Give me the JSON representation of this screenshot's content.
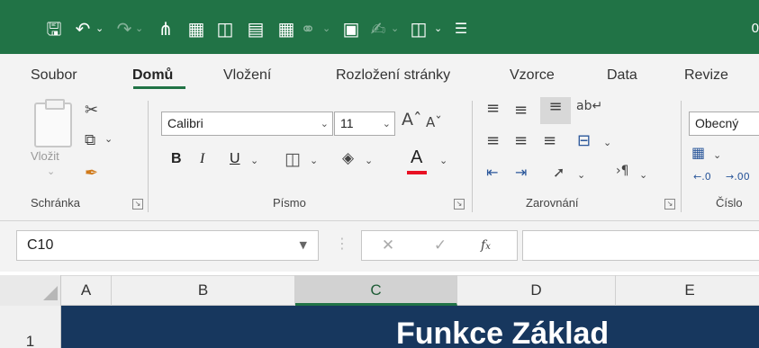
{
  "qat": {
    "title_fragment": "0"
  },
  "tabs": [
    {
      "label": "Soubor"
    },
    {
      "label": "Domů"
    },
    {
      "label": "Vložení"
    },
    {
      "label": "Rozložení stránky"
    },
    {
      "label": "Vzorce"
    },
    {
      "label": "Data"
    },
    {
      "label": "Revize"
    }
  ],
  "clipboard": {
    "paste_label": "Vložit",
    "group_label": "Schránka"
  },
  "font": {
    "name": "Calibri",
    "size": "11",
    "group_label": "Písmo",
    "bold": "B",
    "italic": "I",
    "underline": "U",
    "font_color_letter": "A",
    "underline_color": "#e81123"
  },
  "alignment": {
    "group_label": "Zarovnání"
  },
  "number": {
    "format": "Obecný",
    "group_label": "Číslo"
  },
  "formula_bar": {
    "name_box": "C10",
    "formula": ""
  },
  "columns": [
    "A",
    "B",
    "C",
    "D",
    "E"
  ],
  "selected_column": "C",
  "rows": [
    "1"
  ],
  "cells": {
    "banner_text": "Funkce Základ"
  },
  "colors": {
    "accent": "#217346",
    "banner": "#17375e"
  }
}
